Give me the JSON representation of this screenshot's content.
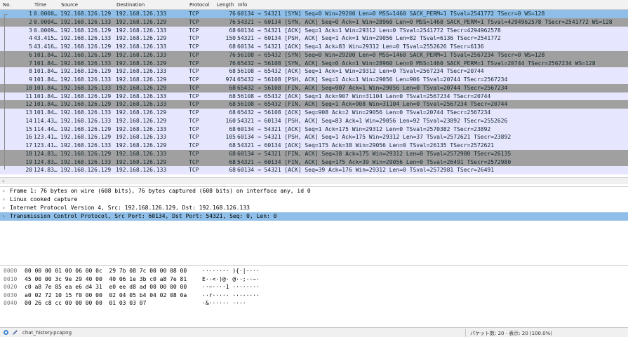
{
  "columns": {
    "no": "No.",
    "time": "Time",
    "source": "Source",
    "destination": "Destination",
    "protocol": "Protocol",
    "length": "Length",
    "info": "Info"
  },
  "packets": [
    {
      "no": "1",
      "time": "0.0000…",
      "src": "192.168.126.129",
      "dst": "192.168.126.133",
      "proto": "TCP",
      "len": "76",
      "info": "60134 → 54321 [SYN] Seq=0 Win=29200 Len=0 MSS=1460 SACK_PERM=1 TSval=2541772 TSecr=0 WS=128",
      "style": "sel"
    },
    {
      "no": "2",
      "time": "0.0004…",
      "src": "192.168.126.133",
      "dst": "192.168.126.129",
      "proto": "TCP",
      "len": "76",
      "info": "54321 → 60134 [SYN, ACK] Seq=0 Ack=1 Win=28960 Len=0 MSS=1460 SACK_PERM=1 TSval=4294962578 TSecr=2541772 WS=128",
      "style": "syn"
    },
    {
      "no": "3",
      "time": "0.0009…",
      "src": "192.168.126.129",
      "dst": "192.168.126.133",
      "proto": "TCP",
      "len": "68",
      "info": "60134 → 54321 [ACK] Seq=1 Ack=1 Win=29312 Len=0 TSval=2541772 TSecr=4294962578",
      "style": "tcp"
    },
    {
      "no": "4",
      "time": "43.415…",
      "src": "192.168.126.133",
      "dst": "192.168.126.129",
      "proto": "TCP",
      "len": "150",
      "info": "54321 → 60134 [PSH, ACK] Seq=1 Ack=1 Win=29056 Len=82 TSval=6136 TSecr=2541772",
      "style": "tcp"
    },
    {
      "no": "5",
      "time": "43.416…",
      "src": "192.168.126.129",
      "dst": "192.168.126.133",
      "proto": "TCP",
      "len": "68",
      "info": "60134 → 54321 [ACK] Seq=1 Ack=83 Win=29312 Len=0 TSval=2552626 TSecr=6136",
      "style": "tcp"
    },
    {
      "no": "6",
      "time": "101.84…",
      "src": "192.168.126.129",
      "dst": "192.168.126.133",
      "proto": "TCP",
      "len": "76",
      "info": "56108 → 65432 [SYN] Seq=0 Win=29200 Len=0 MSS=1460 SACK_PERM=1 TSval=2567234 TSecr=0 WS=128",
      "style": "syn"
    },
    {
      "no": "7",
      "time": "101.84…",
      "src": "192.168.126.133",
      "dst": "192.168.126.129",
      "proto": "TCP",
      "len": "76",
      "info": "65432 → 56108 [SYN, ACK] Seq=0 Ack=1 Win=28960 Len=0 MSS=1460 SACK_PERM=1 TSval=20744 TSecr=2567234 WS=128",
      "style": "syn"
    },
    {
      "no": "8",
      "time": "101.84…",
      "src": "192.168.126.129",
      "dst": "192.168.126.133",
      "proto": "TCP",
      "len": "68",
      "info": "56108 → 65432 [ACK] Seq=1 Ack=1 Win=29312 Len=0 TSval=2567234 TSecr=20744",
      "style": "tcp"
    },
    {
      "no": "9",
      "time": "101.84…",
      "src": "192.168.126.133",
      "dst": "192.168.126.129",
      "proto": "TCP",
      "len": "974",
      "info": "65432 → 56108 [PSH, ACK] Seq=1 Ack=1 Win=29056 Len=906 TSval=20744 TSecr=2567234",
      "style": "tcp"
    },
    {
      "no": "10",
      "time": "101.84…",
      "src": "192.168.126.133",
      "dst": "192.168.126.129",
      "proto": "TCP",
      "len": "68",
      "info": "65432 → 56108 [FIN, ACK] Seq=907 Ack=1 Win=29056 Len=0 TSval=20744 TSecr=2567234",
      "style": "syn"
    },
    {
      "no": "11",
      "time": "101.84…",
      "src": "192.168.126.129",
      "dst": "192.168.126.133",
      "proto": "TCP",
      "len": "68",
      "info": "56108 → 65432 [ACK] Seq=1 Ack=907 Win=31104 Len=0 TSval=2567234 TSecr=20744",
      "style": "tcp"
    },
    {
      "no": "12",
      "time": "101.84…",
      "src": "192.168.126.129",
      "dst": "192.168.126.133",
      "proto": "TCP",
      "len": "68",
      "info": "56108 → 65432 [FIN, ACK] Seq=1 Ack=908 Win=31104 Len=0 TSval=2567234 TSecr=20744",
      "style": "syn"
    },
    {
      "no": "13",
      "time": "101.84…",
      "src": "192.168.126.133",
      "dst": "192.168.126.129",
      "proto": "TCP",
      "len": "68",
      "info": "65432 → 56108 [ACK] Seq=908 Ack=2 Win=29056 Len=0 TSval=20744 TSecr=2567234",
      "style": "tcp"
    },
    {
      "no": "14",
      "time": "114.43…",
      "src": "192.168.126.133",
      "dst": "192.168.126.129",
      "proto": "TCP",
      "len": "160",
      "info": "54321 → 60134 [PSH, ACK] Seq=83 Ack=1 Win=29056 Len=92 TSval=23892 TSecr=2552626",
      "style": "tcp"
    },
    {
      "no": "15",
      "time": "114.44…",
      "src": "192.168.126.129",
      "dst": "192.168.126.133",
      "proto": "TCP",
      "len": "68",
      "info": "60134 → 54321 [ACK] Seq=1 Ack=175 Win=29312 Len=0 TSval=2570382 TSecr=23892",
      "style": "tcp"
    },
    {
      "no": "16",
      "time": "123.41…",
      "src": "192.168.126.129",
      "dst": "192.168.126.133",
      "proto": "TCP",
      "len": "105",
      "info": "60134 → 54321 [PSH, ACK] Seq=1 Ack=175 Win=29312 Len=37 TSval=2572621 TSecr=23892",
      "style": "tcp"
    },
    {
      "no": "17",
      "time": "123.41…",
      "src": "192.168.126.133",
      "dst": "192.168.126.129",
      "proto": "TCP",
      "len": "68",
      "info": "54321 → 60134 [ACK] Seq=175 Ack=38 Win=29056 Len=0 TSval=26135 TSecr=2572621",
      "style": "tcp"
    },
    {
      "no": "18",
      "time": "124.83…",
      "src": "192.168.126.129",
      "dst": "192.168.126.133",
      "proto": "TCP",
      "len": "68",
      "info": "60134 → 54321 [FIN, ACK] Seq=38 Ack=175 Win=29312 Len=0 TSval=2572980 TSecr=26135",
      "style": "syn"
    },
    {
      "no": "19",
      "time": "124.83…",
      "src": "192.168.126.133",
      "dst": "192.168.126.129",
      "proto": "TCP",
      "len": "68",
      "info": "54321 → 60134 [FIN, ACK] Seq=175 Ack=39 Win=29056 Len=0 TSval=26491 TSecr=2572980",
      "style": "syn"
    },
    {
      "no": "20",
      "time": "124.83…",
      "src": "192.168.126.129",
      "dst": "192.168.126.133",
      "proto": "TCP",
      "len": "68",
      "info": "60134 → 54321 [ACK] Seq=39 Ack=176 Win=29312 Len=0 TSval=2572981 TSecr=26491",
      "style": "tcp"
    }
  ],
  "details": [
    {
      "text": "Frame 1: 76 bytes on wire (608 bits), 76 bytes captured (608 bits) on interface any, id 0",
      "selected": false
    },
    {
      "text": "Linux cooked capture",
      "selected": false
    },
    {
      "text": "Internet Protocol Version 4, Src: 192.168.126.129, Dst: 192.168.126.133",
      "selected": false
    },
    {
      "text": "Transmission Control Protocol, Src Port: 60134, Dst Port: 54321, Seq: 0, Len: 0",
      "selected": true
    }
  ],
  "bytes": [
    {
      "off": "0000",
      "hex": "00 00 00 01 00 06 00 0c  29 7b 08 7c 00 00 08 00",
      "ascii": "········ ){·|····"
    },
    {
      "off": "0010",
      "hex": "45 00 00 3c 9e 29 40 00  40 06 1e 3b c0 a8 7e 81",
      "ascii": "E··<·)@· @··;··~·"
    },
    {
      "off": "0020",
      "hex": "c0 a8 7e 85 ea e6 d4 31  e0 ee d8 ad 00 00 00 00",
      "ascii": "··~····1 ········"
    },
    {
      "off": "0030",
      "hex": "a0 02 72 10 15 f0 00 00  02 04 05 b4 04 02 08 0a",
      "ascii": "··r····· ········"
    },
    {
      "off": "0040",
      "hex": "00 26 c8 cc 00 00 00 00  01 03 03 07",
      "ascii": "·&······ ····"
    }
  ],
  "status": {
    "file": "chat_history.pcapng",
    "counts": "パケット数: 20 · 表示: 20 (100.0%)"
  },
  "colors": {
    "selected": "#8fbfe8",
    "tcp": "#e7e6ff",
    "syn_fin": "#a0a0a0"
  }
}
